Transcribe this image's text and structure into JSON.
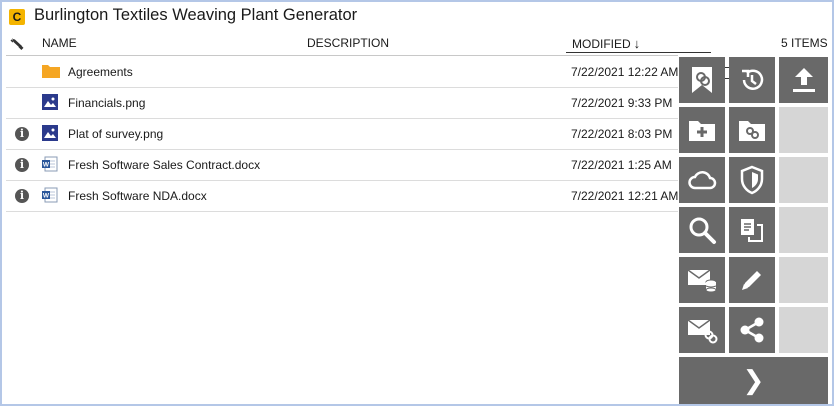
{
  "title": "Burlington Textiles Weaving Plant Generator",
  "app_badge": "C",
  "columns": {
    "name": "NAME",
    "description": "DESCRIPTION",
    "modified": "MODIFIED",
    "sort_arrow": "↓",
    "items_count": "5 ITEMS"
  },
  "files": [
    {
      "name": "Agreements",
      "modified": "7/22/2021 12:22 AM",
      "type": "folder",
      "info": false
    },
    {
      "name": "Financials.png",
      "modified": "7/22/2021 9:33 PM",
      "type": "image",
      "info": false
    },
    {
      "name": "Plat of survey.png",
      "modified": "7/22/2021 8:03 PM",
      "type": "image",
      "info": true
    },
    {
      "name": "Fresh Software Sales Contract.docx",
      "modified": "7/22/2021 1:25 AM",
      "type": "word",
      "info": true
    },
    {
      "name": "Fresh Software NDA.docx",
      "modified": "7/22/2021 12:21 AM",
      "type": "word",
      "info": true
    }
  ],
  "info_glyph": "i",
  "colors": {
    "accent_folder": "#f5a623",
    "tile": "#696969",
    "tile_empty": "#d6d6d6",
    "border": "#b4c7e7"
  },
  "action_icons": [
    "link-bookmark-icon",
    "restore-icon",
    "upload-icon",
    "new-folder-icon",
    "folder-link-icon",
    "cloud-icon",
    "shield-icon",
    "search-icon",
    "copy-document-icon",
    "email-database-icon",
    "edit-pencil-icon",
    "email-link-icon",
    "share-icon",
    "next-chevron-icon"
  ],
  "next_glyph": "❯"
}
